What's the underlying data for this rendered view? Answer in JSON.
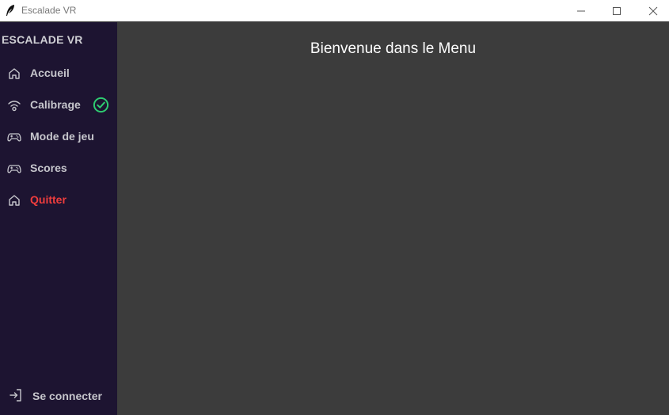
{
  "window": {
    "title": "Escalade VR",
    "icon": "feather-icon"
  },
  "sidebar": {
    "brand": "ESCALADE VR",
    "items": [
      {
        "label": "Accueil",
        "icon": "home-icon"
      },
      {
        "label": "Calibrage",
        "icon": "wifi-icon",
        "status_icon": "check-circle-icon"
      },
      {
        "label": "Mode de jeu",
        "icon": "gamepad-icon"
      },
      {
        "label": "Scores",
        "icon": "gamepad-icon"
      },
      {
        "label": "Quitter",
        "icon": "home-icon"
      }
    ],
    "footer": {
      "label": "Se connecter",
      "icon": "login-icon"
    }
  },
  "main": {
    "heading": "Bienvenue dans le Menu"
  },
  "colors": {
    "sidebar_bg": "#1d1431",
    "main_bg": "#3c3c3c",
    "danger": "#ef3d3d",
    "success": "#2ecc71"
  }
}
